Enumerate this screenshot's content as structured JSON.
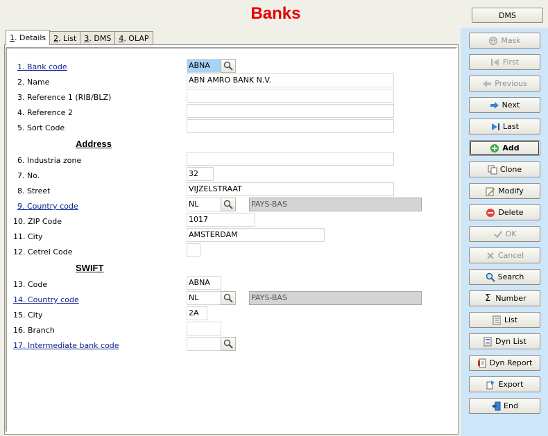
{
  "window": {
    "title": "Banks",
    "dms_button": "DMS"
  },
  "tabs": [
    {
      "num": "1",
      "label": ". Details",
      "active": true
    },
    {
      "num": "2",
      "label": ". List"
    },
    {
      "num": "3",
      "label": ". DMS"
    },
    {
      "num": "4",
      "label": ". OLAP"
    }
  ],
  "form": {
    "bank_code": {
      "label": "1. Bank code",
      "value": "ABNA"
    },
    "name": {
      "label": "2. Name",
      "value": "ABN AMRO BANK N.V."
    },
    "reference1": {
      "label": "3. Reference 1 (RIB/BLZ)",
      "value": ""
    },
    "reference2": {
      "label": "4. Reference 2",
      "value": ""
    },
    "sort_code": {
      "label": "5. Sort Code",
      "value": ""
    },
    "address_heading": "Address",
    "industria_zone": {
      "label": "6. Industria zone",
      "value": ""
    },
    "no": {
      "label": "7. No.",
      "value": "32"
    },
    "street": {
      "label": "8. Street",
      "value": "VIJZELSTRAAT"
    },
    "country_code": {
      "label": "9. Country code",
      "value": "NL",
      "description": "PAYS-BAS"
    },
    "zip": {
      "label": "10. ZIP Code",
      "value": "1017"
    },
    "city": {
      "label": "11. City",
      "value": "AMSTERDAM"
    },
    "cetrel": {
      "label": "12. Cetrel Code",
      "value": ""
    },
    "swift_heading": "SWIFT",
    "swift_code": {
      "label": "13. Code",
      "value": "ABNA"
    },
    "swift_country": {
      "label": "14. Country code",
      "value": "NL",
      "description": "PAYS-BAS"
    },
    "swift_city": {
      "label": "15. City",
      "value": "2A"
    },
    "branch": {
      "label": "16. Branch",
      "value": ""
    },
    "intermediate": {
      "label": "17. Intermediate bank code",
      "value": ""
    }
  },
  "actions": {
    "mask": "Mask",
    "first": "First",
    "previous": "Previous",
    "next": "Next",
    "last": "Last",
    "add": "Add",
    "clone": "Clone",
    "modify": "Modify",
    "delete": "Delete",
    "ok": "OK",
    "cancel": "Cancel",
    "search": "Search",
    "number": "Number",
    "list": "List",
    "dyn_list": "Dyn List",
    "dyn_report": "Dyn Report",
    "export": "Export",
    "end": "End"
  }
}
